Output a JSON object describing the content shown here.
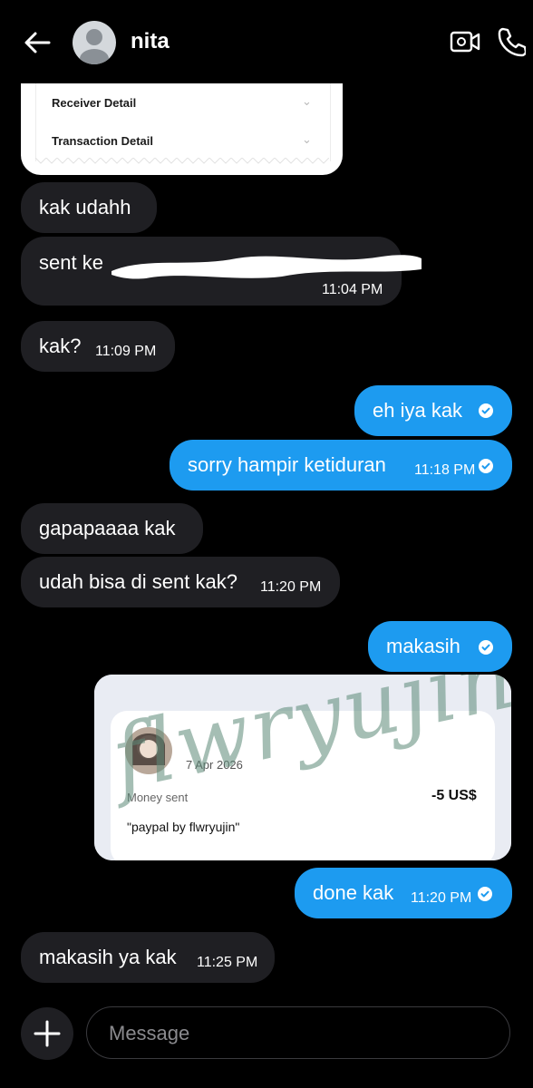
{
  "header": {
    "contact_name": "nita"
  },
  "receipt_top": {
    "rows": [
      "Receiver Detail",
      "Transaction Detail"
    ]
  },
  "messages": [
    {
      "text": "kak udahh",
      "time": ""
    },
    {
      "text": "sent ke",
      "time": "11:04 PM"
    },
    {
      "text": "kak?",
      "time": "11:09 PM"
    },
    {
      "text": "eh iya kak",
      "time": ""
    },
    {
      "text": "sorry hampir ketiduran",
      "time": "11:18 PM"
    },
    {
      "text": "gapapaaaa kak",
      "time": ""
    },
    {
      "text": "udah bisa di sent kak?",
      "time": "11:20 PM"
    },
    {
      "text": "makasih",
      "time": ""
    },
    {
      "text": "done kak",
      "time": "11:20 PM"
    },
    {
      "text": "makasih ya kak",
      "time": "11:25 PM"
    }
  ],
  "payment_card": {
    "date": "7 Apr 2026",
    "status": "Money sent",
    "amount": "-5 US$",
    "note": "\"paypal by flwryujin\"",
    "watermark": "flwryujin"
  },
  "composer": {
    "placeholder": "Message"
  },
  "colors": {
    "background": "#000000",
    "incoming_bubble": "#1f1f23",
    "outgoing_bubble": "#1d9bf0",
    "watermark": "#5d8a78"
  },
  "icons": [
    "back-arrow-icon",
    "avatar-placeholder-icon",
    "video-call-icon",
    "phone-icon",
    "read-check-icon",
    "plus-icon"
  ]
}
